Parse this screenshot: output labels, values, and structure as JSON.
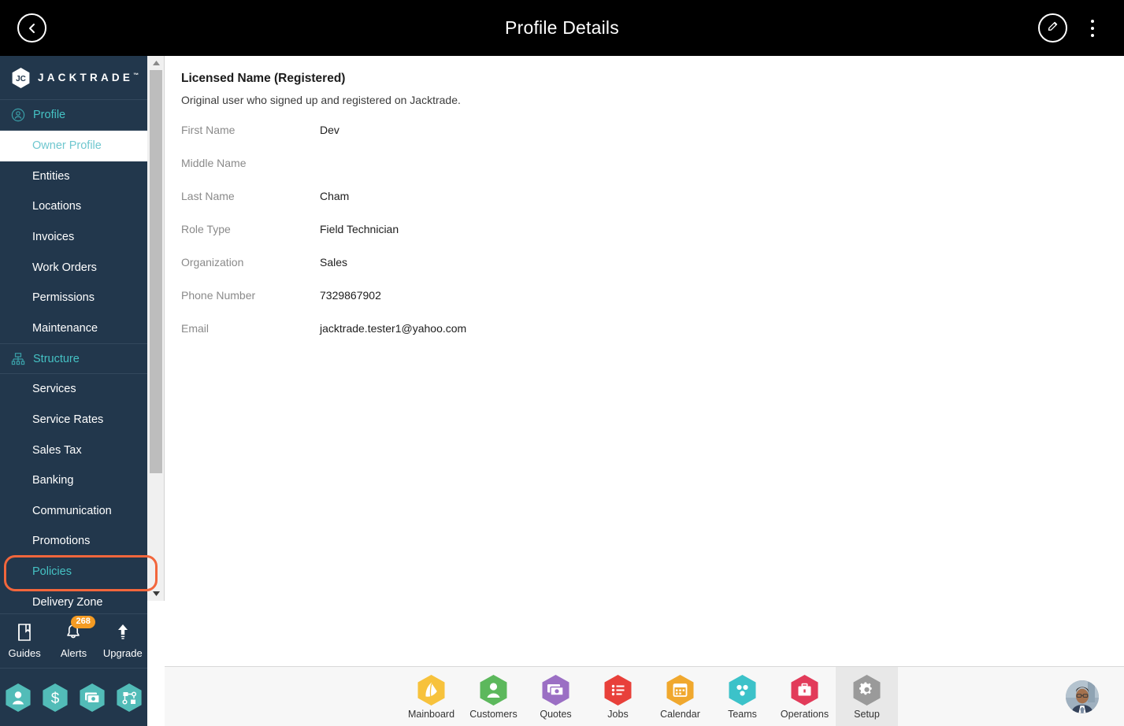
{
  "header": {
    "title": "Profile Details",
    "back_icon": "chevron-left-icon",
    "edit_icon": "pencil-icon",
    "menu_icon": "kebab-menu-icon"
  },
  "sidebar": {
    "brand": {
      "name": "JACKTRADE",
      "tm": "™",
      "mark": "jc-hexagon-logo"
    },
    "groups": [
      {
        "label": "Profile",
        "icon": "user-circle-icon",
        "items": [
          {
            "label": "Owner Profile",
            "active": true
          },
          {
            "label": "Entities",
            "active": false
          },
          {
            "label": "Locations",
            "active": false
          },
          {
            "label": "Invoices",
            "active": false
          },
          {
            "label": "Work Orders",
            "active": false
          },
          {
            "label": "Permissions",
            "active": false
          },
          {
            "label": "Maintenance",
            "active": false
          }
        ]
      },
      {
        "label": "Structure",
        "icon": "hierarchy-icon",
        "items": [
          {
            "label": "Services",
            "active": false
          },
          {
            "label": "Service Rates",
            "active": false
          },
          {
            "label": "Sales Tax",
            "active": false
          },
          {
            "label": "Banking",
            "active": false
          },
          {
            "label": "Communication",
            "active": false
          },
          {
            "label": "Promotions",
            "active": false
          },
          {
            "label": "Policies",
            "active": false,
            "highlighted": true
          },
          {
            "label": "Delivery Zone",
            "active": false
          }
        ]
      }
    ],
    "quick_actions": [
      {
        "label": "Guides",
        "icon": "book-icon",
        "badge": ""
      },
      {
        "label": "Alerts",
        "icon": "bell-icon",
        "badge": "268"
      },
      {
        "label": "Upgrade",
        "icon": "up-arrow-icon",
        "badge": ""
      }
    ],
    "shortcut_hexes": [
      {
        "icon": "person-icon"
      },
      {
        "icon": "dollar-icon"
      },
      {
        "icon": "money-exchange-icon"
      },
      {
        "icon": "workflow-icon"
      }
    ],
    "scrollbar": {
      "up_icon": "triangle-up-icon",
      "down_icon": "triangle-down-icon"
    }
  },
  "main": {
    "section_title": "Licensed Name (Registered)",
    "section_desc": "Original user who signed up and registered on Jacktrade.",
    "fields": [
      {
        "label": "First Name",
        "value": "Dev"
      },
      {
        "label": "Middle Name",
        "value": ""
      },
      {
        "label": "Last Name",
        "value": "Cham"
      },
      {
        "label": "Role Type",
        "value": "Field Technician"
      },
      {
        "label": "Organization",
        "value": "Sales"
      },
      {
        "label": "Phone Number",
        "value": "7329867902"
      },
      {
        "label": "Email",
        "value": "jacktrade.tester1@yahoo.com"
      }
    ]
  },
  "bottom_nav": {
    "items": [
      {
        "label": "Mainboard",
        "icon": "fan-icon",
        "color": "#f7c23c",
        "active": false
      },
      {
        "label": "Customers",
        "icon": "person-icon",
        "color": "#5cb85c",
        "active": false
      },
      {
        "label": "Quotes",
        "icon": "money-exchange-icon",
        "color": "#9b6fc4",
        "active": false
      },
      {
        "label": "Jobs",
        "icon": "checklist-icon",
        "color": "#e8403a",
        "active": false
      },
      {
        "label": "Calendar",
        "icon": "calendar-icon",
        "color": "#f0a82e",
        "active": false
      },
      {
        "label": "Teams",
        "icon": "teams-icon",
        "color": "#3cc2c9",
        "active": false
      },
      {
        "label": "Operations",
        "icon": "briefcase-icon",
        "color": "#e23b5a",
        "active": false
      },
      {
        "label": "Setup",
        "icon": "gear-icon",
        "color": "#9a9a9a",
        "active": true
      }
    ],
    "avatar": "user-avatar"
  },
  "colors": {
    "sidebar_bg": "#22374c",
    "accent_teal": "#45c2c4",
    "highlight_orange": "#f2663c",
    "badge_orange": "#f59b23",
    "topbar_bg": "#000000"
  }
}
